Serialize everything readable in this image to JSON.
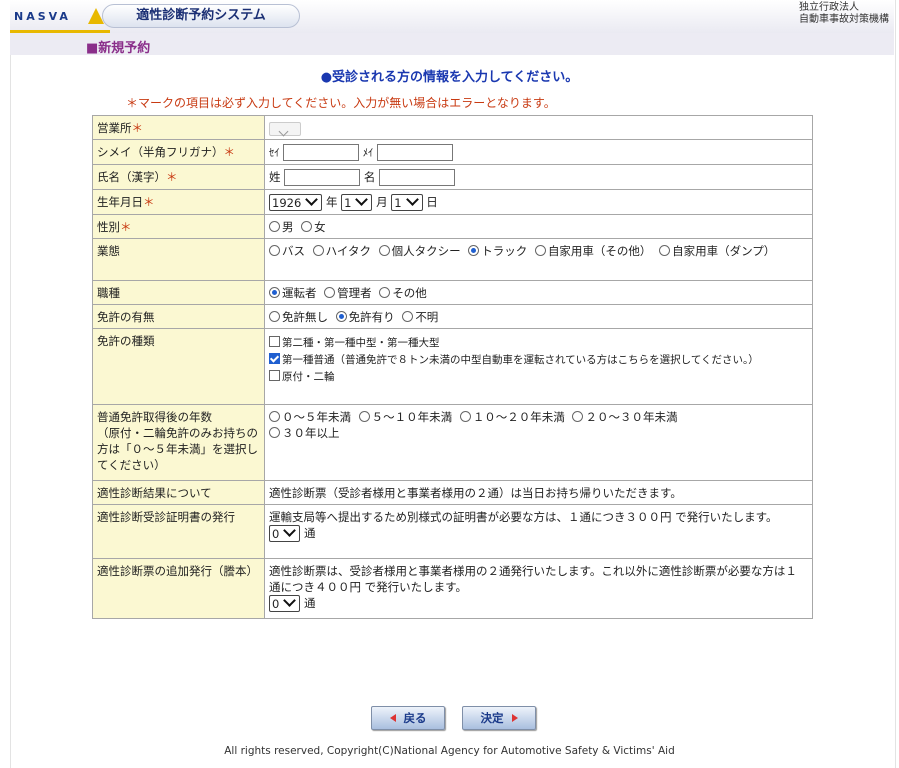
{
  "header": {
    "logo_text": "NASVA",
    "app_title": "適性診断予約システム",
    "org_line1": "独立行政法人",
    "org_line2": "自動車事故対策機構"
  },
  "section_title": "■新規予約",
  "intro": "●受診される方の情報を入力してください。",
  "warning": "＊マークの項目は必ず入力してください。入力が無い場合はエラーとなります。",
  "required_mark": "＊",
  "form": {
    "office": {
      "label": "営業所"
    },
    "kana": {
      "label": "シメイ（半角フリガナ）",
      "sei": "ｾｲ",
      "mei": "ﾒｲ",
      "sei_value": "",
      "mei_value": ""
    },
    "kanji": {
      "label": "氏名（漢字）",
      "sei": "姓",
      "mei": "名",
      "sei_value": "",
      "mei_value": ""
    },
    "birth": {
      "label": "生年月日",
      "year": "1926",
      "year_unit": "年",
      "month": "1",
      "month_unit": "月",
      "day": "1",
      "day_unit": "日"
    },
    "gender": {
      "label": "性別",
      "options": [
        "男",
        "女"
      ],
      "selected": null
    },
    "business": {
      "label": "業態",
      "options": [
        "バス",
        "ハイタク",
        "個人タクシー",
        "トラック",
        "自家用車（その他）",
        "自家用車（ダンプ）"
      ],
      "selected": "トラック"
    },
    "job": {
      "label": "職種",
      "options": [
        "運転者",
        "管理者",
        "その他"
      ],
      "selected": "運転者"
    },
    "license": {
      "label": "免許の有無",
      "options": [
        "免許無し",
        "免許有り",
        "不明"
      ],
      "selected": "免許有り"
    },
    "license_type": {
      "label": "免許の種類",
      "options": [
        {
          "text": "第二種・第一種中型・第一種大型",
          "checked": false
        },
        {
          "text": "第一種普通（普通免許で８トン未満の中型自動車を運転されている方はこちらを選択してください。）",
          "checked": true
        },
        {
          "text": "原付・二輪",
          "checked": false
        }
      ]
    },
    "years": {
      "label": "普通免許取得後の年数\n（原付・二輪免許のみお持ちの方は「０～５年未満」を選択してください）",
      "options": [
        "０～５年未満",
        "５～１０年未満",
        "１０～２０年未満",
        "２０～３０年未満",
        "３０年以上"
      ],
      "selected": null
    },
    "result": {
      "label": "適性診断結果について",
      "text": "適性診断票（受診者様用と事業者様用の２通）は当日お持ち帰りいただきます。"
    },
    "certificate": {
      "label": "適性診断受診証明書の発行",
      "text": "運輸支局等へ提出するため別様式の証明書が必要な方は、１通につき３００円 で発行いたします。",
      "count": "0",
      "unit": "通"
    },
    "extra": {
      "label": "適性診断票の追加発行（謄本）",
      "text": "適性診断票は、受診者様用と事業者様用の２通発行いたします。これ以外に適性診断票が必要な方は１通につき４００円 で発行いたします。",
      "count": "0",
      "unit": "通"
    }
  },
  "buttons": {
    "back": "戻る",
    "confirm": "決定"
  },
  "footer": "All rights reserved, Copyright(C)National Agency for Automotive Safety & Victims' Aid",
  "colors": {
    "label_bg": "#fbf8d2",
    "required": "#c83a12",
    "intro": "#1a38b0",
    "section": "#8a2e8a"
  }
}
